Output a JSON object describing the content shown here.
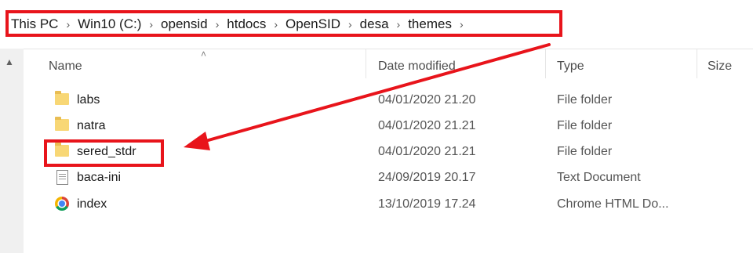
{
  "breadcrumb": [
    "This PC",
    "Win10 (C:)",
    "opensid",
    "htdocs",
    "OpenSID",
    "desa",
    "themes"
  ],
  "columns": {
    "name": "Name",
    "date": "Date modified",
    "type": "Type",
    "size": "Size"
  },
  "files": [
    {
      "name": "labs",
      "date": "04/01/2020 21.20",
      "type": "File folder",
      "icon": "folder-icon"
    },
    {
      "name": "natra",
      "date": "04/01/2020 21.21",
      "type": "File folder",
      "icon": "folder-icon"
    },
    {
      "name": "sered_stdr",
      "date": "04/01/2020 21.21",
      "type": "File folder",
      "icon": "folder-icon"
    },
    {
      "name": "baca-ini",
      "date": "24/09/2019 20.17",
      "type": "Text Document",
      "icon": "text-document-icon"
    },
    {
      "name": "index",
      "date": "13/10/2019 17.24",
      "type": "Chrome HTML Do...",
      "icon": "chrome-icon"
    }
  ],
  "annotation_color": "#e8141b"
}
